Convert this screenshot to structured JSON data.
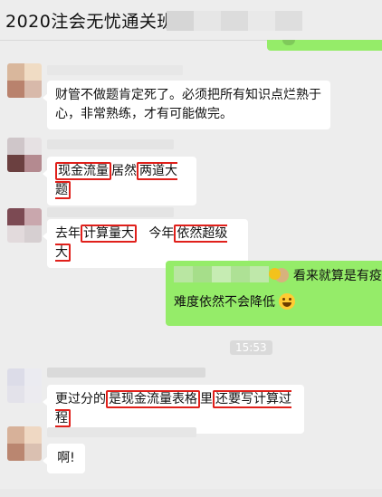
{
  "header": {
    "title": "2020注会无忧通关班"
  },
  "messages": [
    {
      "text": "财管不做题肯定死了。必须把所有知识点烂熟于心，非常熟练，才有可能做完。"
    },
    {
      "parts": [
        "现金流量",
        "居然",
        "两道大题"
      ]
    },
    {
      "parts": [
        "去年",
        "计算量大",
        "   今年",
        "依然超级大"
      ]
    },
    {
      "line1": "看来就算是有疫情",
      "line2": "难度依然不会降低"
    },
    {
      "parts": [
        "更过分的",
        "是现金流量表格",
        "里",
        "还要写计算过程"
      ]
    },
    {
      "text": "啊!"
    }
  ],
  "timestamp": "15:53",
  "colors": {
    "bg": "#ededed",
    "bubble_green": "#95ec69",
    "highlight": "#e0201b"
  }
}
